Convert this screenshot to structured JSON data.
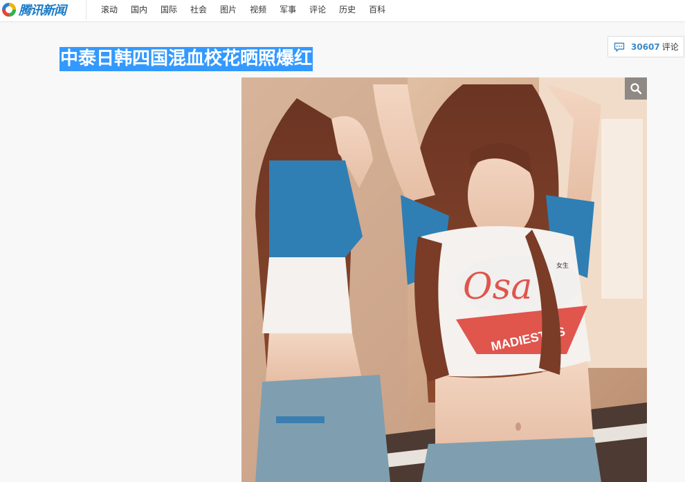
{
  "header": {
    "logo_text": "腾讯新闻",
    "nav": [
      "滚动",
      "国内",
      "国际",
      "社会",
      "图片",
      "视频",
      "军事",
      "评论",
      "历史",
      "百科"
    ]
  },
  "article": {
    "title": "中泰日韩四国混血校花晒照爆红"
  },
  "comments": {
    "count": "30607",
    "label": "评论"
  },
  "photo": {
    "shirt_text": "MADIEST.DS",
    "shirt_logo": "Osa",
    "shirt_small_text": "女生"
  },
  "colors": {
    "brand_blue": "#1a7ac6",
    "selection": "#3399ff",
    "comment_count": "#3b88c8"
  },
  "icons": {
    "logo": "tencent-logo-icon",
    "comment": "speech-bubble-icon",
    "zoom": "magnifier-icon"
  }
}
